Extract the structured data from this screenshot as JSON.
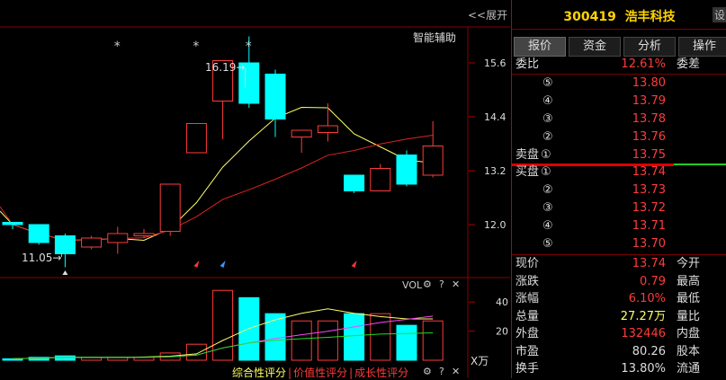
{
  "chart_panel": {
    "collapse_label": "<<展开",
    "aux_label": "智能辅助",
    "annotations": {
      "high": "16.19",
      "low": "11.05"
    },
    "vol_label": "VOL",
    "volume_unit": "X万",
    "star_marker": "*",
    "scores": [
      "综合性评分",
      "价值性评分",
      "成长性评分"
    ],
    "colors": {
      "up": "#ff3b3b",
      "down": "#00ffff",
      "ma_yellow": "#ffff66",
      "ma_red": "#dd2222",
      "ma_magenta": "#ff44ff",
      "ma_green": "#22dd22"
    }
  },
  "chart_data": {
    "type": "candlestick",
    "price_axis": {
      "ticks": [
        12.0,
        13.2,
        14.4,
        15.6
      ],
      "ylim": [
        11.0,
        16.4
      ]
    },
    "volume_axis": {
      "ticks": [
        20,
        40
      ],
      "ylim": [
        0,
        50
      ]
    },
    "candles": [
      {
        "open": 12.05,
        "close": 12.0,
        "high": 12.05,
        "low": 11.9,
        "vol": 1
      },
      {
        "open": 12.0,
        "close": 11.6,
        "high": 12.0,
        "low": 11.55,
        "vol": 2
      },
      {
        "open": 11.75,
        "close": 11.35,
        "high": 11.8,
        "low": 11.05,
        "vol": 3
      },
      {
        "open": 11.5,
        "close": 11.7,
        "high": 11.75,
        "low": 11.45,
        "vol": 2
      },
      {
        "open": 11.6,
        "close": 11.8,
        "high": 11.95,
        "low": 11.35,
        "vol": 2
      },
      {
        "open": 11.75,
        "close": 11.8,
        "high": 11.9,
        "low": 11.7,
        "vol": 2
      },
      {
        "open": 11.85,
        "close": 12.9,
        "high": 12.9,
        "low": 11.75,
        "vol": 5
      },
      {
        "open": 13.6,
        "close": 14.25,
        "high": 14.25,
        "low": 13.6,
        "vol": 11
      },
      {
        "open": 14.75,
        "close": 15.65,
        "high": 15.65,
        "low": 13.9,
        "vol": 48
      },
      {
        "open": 15.6,
        "close": 14.7,
        "high": 16.19,
        "low": 14.6,
        "vol": 43
      },
      {
        "open": 15.35,
        "close": 14.35,
        "high": 15.45,
        "low": 13.95,
        "vol": 32
      },
      {
        "open": 13.95,
        "close": 14.1,
        "high": 14.1,
        "low": 13.6,
        "vol": 27
      },
      {
        "open": 14.05,
        "close": 14.2,
        "high": 14.7,
        "low": 13.85,
        "vol": 27
      },
      {
        "open": 13.1,
        "close": 12.75,
        "high": 13.1,
        "low": 12.7,
        "vol": 32
      },
      {
        "open": 12.75,
        "close": 13.25,
        "high": 13.35,
        "low": 12.75,
        "vol": 32
      },
      {
        "open": 13.55,
        "close": 12.9,
        "high": 13.65,
        "low": 12.85,
        "vol": 24
      },
      {
        "open": 13.1,
        "close": 13.75,
        "high": 14.3,
        "low": 13.05,
        "vol": 27
      }
    ]
  },
  "stock": {
    "code": "300419",
    "name": "浩丰科技",
    "title_btn": "设"
  },
  "tabs": [
    "报价",
    "资金",
    "分析",
    "操作"
  ],
  "weibi": {
    "label": "委比",
    "value": "12.61%",
    "label2": "委差"
  },
  "sell": {
    "prefix": "卖盘",
    "levels": [
      {
        "level": "⑤",
        "price": "13.80"
      },
      {
        "level": "④",
        "price": "13.79"
      },
      {
        "level": "③",
        "price": "13.78"
      },
      {
        "level": "②",
        "price": "13.76"
      },
      {
        "level": "①",
        "price": "13.75"
      }
    ]
  },
  "buy": {
    "prefix": "买盘",
    "levels": [
      {
        "level": "①",
        "price": "13.74"
      },
      {
        "level": "②",
        "price": "13.73"
      },
      {
        "level": "③",
        "price": "13.72"
      },
      {
        "level": "④",
        "price": "13.71"
      },
      {
        "level": "⑤",
        "price": "13.70"
      }
    ]
  },
  "stats": [
    {
      "label": "现价",
      "value": "13.74",
      "label2": "今开"
    },
    {
      "label": "涨跌",
      "value": "0.79",
      "label2": "最高"
    },
    {
      "label": "涨幅",
      "value": "6.10%",
      "label2": "最低"
    },
    {
      "label": "总量",
      "value": "27.27万",
      "label2": "量比"
    },
    {
      "label": "外盘",
      "value": "132446",
      "label2": "内盘"
    },
    {
      "label": "市盈",
      "value": "80.26",
      "label2": "股本"
    },
    {
      "label": "换手",
      "value": "13.80%",
      "label2": "流通"
    }
  ]
}
